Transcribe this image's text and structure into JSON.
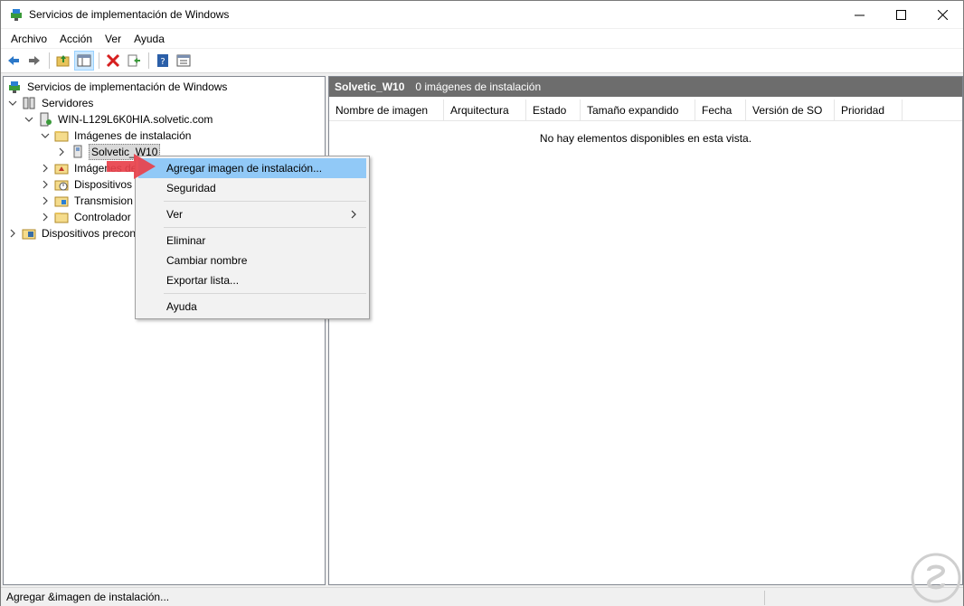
{
  "window": {
    "title": "Servicios de implementación de Windows"
  },
  "menubar": [
    "Archivo",
    "Acción",
    "Ver",
    "Ayuda"
  ],
  "toolbar": [
    "back-icon",
    "forward-icon",
    "up-folder-icon",
    "show-hide-tree-icon",
    "delete-icon",
    "export-icon",
    "help-icon",
    "properties-icon"
  ],
  "tree": {
    "root": "Servicios de implementación de Windows",
    "servers": "Servidores",
    "server": "WIN-L129L6K0HIA.solvetic.com",
    "install_images": "Imágenes de instalación",
    "group": "Solvetic_W10",
    "boot_images": "Imágenes de",
    "devices": "Dispositivos",
    "transmissions": "Transmision",
    "drivers": "Controlador",
    "prestaged": "Dispositivos precon"
  },
  "right_pane": {
    "header_name": "Solvetic_W10",
    "header_count": "0 imágenes de instalación",
    "columns": [
      "Nombre de imagen",
      "Arquitectura",
      "Estado",
      "Tamaño expandido",
      "Fecha",
      "Versión de SO",
      "Prioridad"
    ],
    "empty_message": "No hay elementos disponibles en esta vista."
  },
  "context_menu": {
    "add_image": "Agregar imagen de instalación...",
    "security": "Seguridad",
    "view": "Ver",
    "delete": "Eliminar",
    "rename": "Cambiar nombre",
    "export": "Exportar lista...",
    "help": "Ayuda"
  },
  "statusbar": {
    "text": "Agregar &imagen de instalación..."
  },
  "colors": {
    "menu_highlight": "#91c9f7",
    "pane_header": "#6d6d6d",
    "pointer_arrow": "#e8414b"
  }
}
